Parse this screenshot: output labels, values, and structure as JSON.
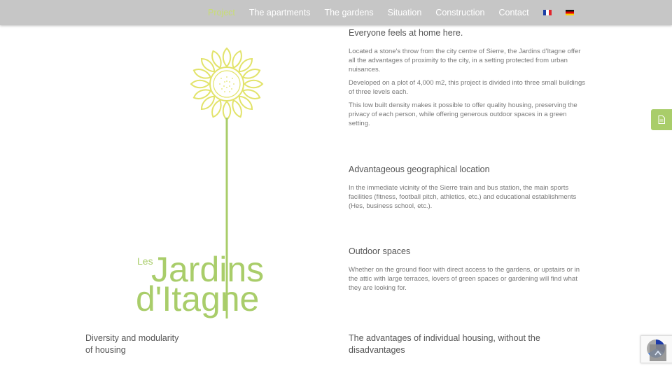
{
  "nav": {
    "items": [
      "Project",
      "The apartments",
      "The gardens",
      "Situation",
      "Construction",
      "Contact"
    ],
    "active_index": 0,
    "languages": [
      "French flag",
      "German flag"
    ]
  },
  "logo": {
    "small_text": "Les",
    "line1": "Jardins",
    "line2": "d'Itagne",
    "color": "#a9cd6a"
  },
  "sections": [
    {
      "title": "Everyone feels at home here.",
      "paragraphs": [
        "Located a stone's throw from the city centre of Sierre, the Jardins d'Itagne offer all the advantages of proximity to the city, in a setting protected from urban nuisances.",
        "Developed on a plot of 4,000 m2, this project is divided into three small buildings of three levels each.",
        "This low built density makes it possible to offer quality housing, preserving the privacy of each person, while offering generous outdoor spaces in a green setting."
      ]
    },
    {
      "title": "Advantageous geographical location",
      "paragraphs": [
        "In the immediate vicinity of the Sierre train and bus station, the main sports facilities (fitness, football pitch, athletics, etc.) and educational establishments (Hes, business school, etc.)."
      ]
    },
    {
      "title": "Outdoor spaces",
      "paragraphs": [
        "Whether on the ground floor with direct access to the gardens, or upstairs or in the attic with large terraces, lovers of green spaces or gardening will find what they are looking for."
      ]
    }
  ],
  "bottom": {
    "left_title_line1": "Diversity and modularity",
    "left_title_line2": "of housing",
    "right_title_line1": "The advantages of individual housing, without the",
    "right_title_line2": "disadvantages"
  },
  "icons": {
    "side_tab": "document-icon",
    "back_to_top": "arrow-up-icon",
    "recaptcha": "recaptcha-icon"
  },
  "colors": {
    "accent": "#a9cd6a",
    "nav_bg": "#c6c6c6",
    "active_nav": "#c8dd72"
  }
}
